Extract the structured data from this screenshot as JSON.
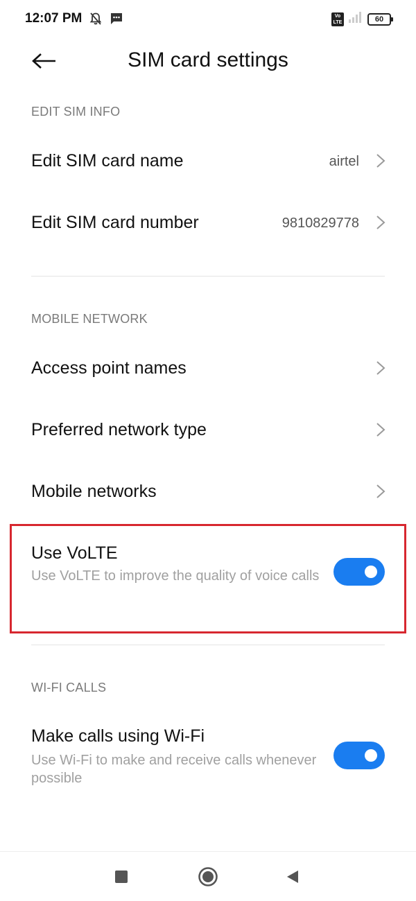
{
  "status_bar": {
    "time": "12:07 PM",
    "icons_left": [
      "bell-off-icon",
      "message-icon"
    ],
    "volte_badge_top": "Vo",
    "volte_badge_bottom": "LTE",
    "signal": "signal-icon",
    "battery": "60"
  },
  "header": {
    "back_icon": "back-arrow-icon",
    "title": "SIM card settings"
  },
  "edit_sim_info": {
    "section_label": "EDIT SIM INFO",
    "items": [
      {
        "title": "Edit SIM card name",
        "value": "airtel"
      },
      {
        "title": "Edit SIM card number",
        "value": "9810829778"
      }
    ]
  },
  "mobile_network": {
    "section_label": "MOBILE NETWORK",
    "items": [
      {
        "title": "Access point names"
      },
      {
        "title": "Preferred network type"
      },
      {
        "title": "Mobile networks"
      }
    ],
    "volte": {
      "title": "Use VoLTE",
      "subtitle": "Use VoLTE to improve the quality of voice calls",
      "enabled": true
    }
  },
  "wifi_calls": {
    "section_label": "WI-FI CALLS",
    "item": {
      "title": "Make calls using Wi-Fi",
      "subtitle": "Use Wi-Fi to make and receive calls whenever possible",
      "enabled": true
    }
  },
  "colors": {
    "accent": "#1a7df0",
    "highlight": "#d7272f",
    "section_label": "#7a7a7a",
    "subtitle": "#a0a0a0"
  },
  "nav_bar": {
    "icons": [
      "recents-square-icon",
      "home-circle-icon",
      "back-triangle-icon"
    ]
  }
}
